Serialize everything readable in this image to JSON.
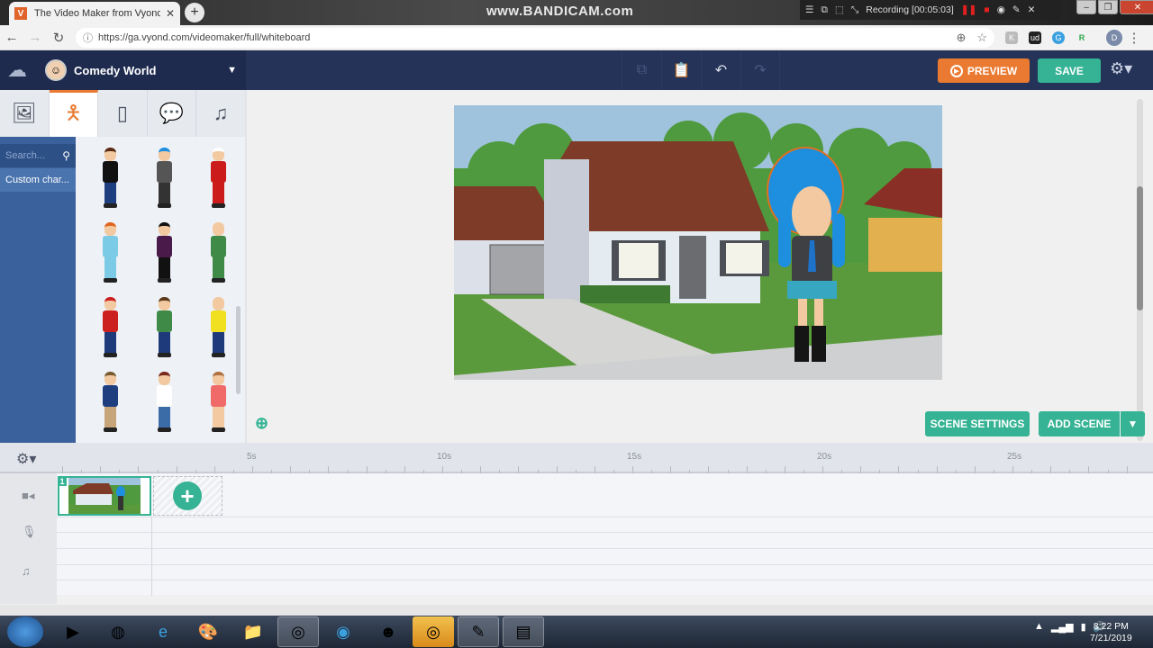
{
  "browser": {
    "tab_title": "The Video Maker from Vyond - M",
    "tab_favicon": "V",
    "new_tab": "+",
    "url": "https://ga.vyond.com/videomaker/full/whiteboard",
    "extensions": [
      "K",
      "ud",
      "G",
      "R"
    ],
    "profile": "D"
  },
  "recorder": {
    "watermark": "www.BANDICAM.com",
    "status": "Recording [00:05:03]"
  },
  "app": {
    "theme_name": "Comedy World",
    "preview_label": "PREVIEW",
    "save_label": "SAVE",
    "asset_tabs": [
      {
        "name": "backgrounds",
        "icon": "image-icon"
      },
      {
        "name": "characters",
        "icon": "person-icon",
        "active": true
      },
      {
        "name": "props",
        "icon": "phone-icon"
      },
      {
        "name": "text",
        "icon": "speech-bubble-icon"
      },
      {
        "name": "audio",
        "icon": "music-icon"
      }
    ],
    "search_placeholder": "Search...",
    "category": "Custom char...",
    "characters": [
      {
        "hair": "#5a2a12",
        "top": "#111111",
        "leg": "#1f3e80"
      },
      {
        "hair": "#1e8ede",
        "top": "#555555",
        "leg": "#333333"
      },
      {
        "hair": "#ffffff",
        "top": "#cc1b1b",
        "leg": "#cc1b1b"
      },
      {
        "hair": "#e0651f",
        "top": "#7ccbe6",
        "leg": "#7ccbe6"
      },
      {
        "hair": "#111111",
        "top": "#4a1a4a",
        "leg": "#111111"
      },
      {
        "hair": "#f2c9a0",
        "top": "#3f8a46",
        "leg": "#3f8a46"
      },
      {
        "hair": "#cc2020",
        "top": "#cc2020",
        "leg": "#1e3a7a"
      },
      {
        "hair": "#5a3a1a",
        "top": "#3f8a46",
        "leg": "#1e3a7a"
      },
      {
        "hair": "#f2c9a0",
        "top": "#f0e020",
        "leg": "#1e3a7a"
      },
      {
        "hair": "#7a5a30",
        "top": "#1f3e80",
        "leg": "#c7a47a"
      },
      {
        "hair": "#7a2a1a",
        "top": "#ffffff",
        "leg": "#3c6ca8"
      },
      {
        "hair": "#b07040",
        "top": "#f06a6a",
        "leg": "#f2c9a0"
      }
    ]
  },
  "stage": {
    "scene_settings_label": "SCENE SETTINGS",
    "add_scene_label": "ADD SCENE"
  },
  "timeline": {
    "ticks": [
      "5s",
      "10s",
      "15s",
      "20s",
      "25s"
    ],
    "scene_number": "1"
  },
  "taskbar": {
    "time": "8:22 PM",
    "date": "7/21/2019"
  }
}
